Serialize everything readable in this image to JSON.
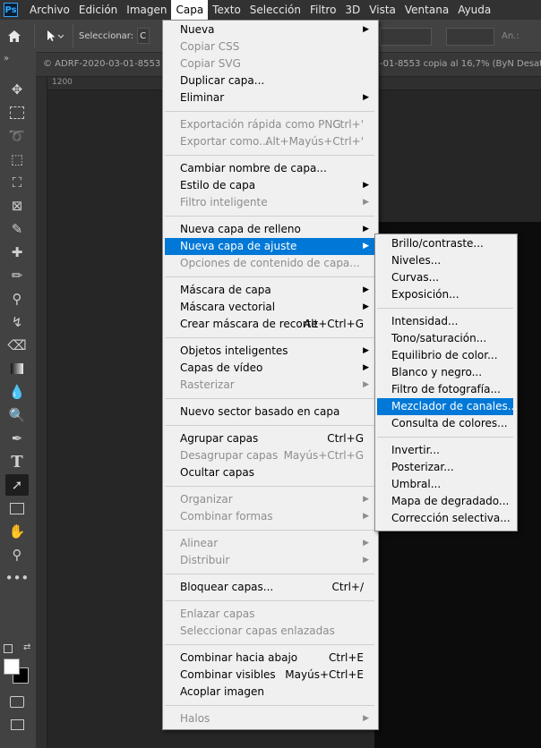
{
  "app": {
    "logo": "Ps"
  },
  "menubar": [
    "Archivo",
    "Edición",
    "Imagen",
    "Capa",
    "Texto",
    "Selección",
    "Filtro",
    "3D",
    "Vista",
    "Ventana",
    "Ayuda"
  ],
  "options": {
    "select_label": "Seleccionar:",
    "select_value": "C",
    "extra_label": "An.:"
  },
  "tabs": {
    "left": "© ADRF-2020-03-01-8553",
    "right": "-01-8553 copia al 16,7% (ByN Desat"
  },
  "ruler": {
    "tick": "1200"
  },
  "tools": {
    "double_arrow": "»"
  },
  "layer_menu": [
    {
      "label": "Nueva",
      "sub": true
    },
    {
      "label": "Copiar CSS",
      "disabled": true
    },
    {
      "label": "Copiar SVG",
      "disabled": true
    },
    {
      "label": "Duplicar capa..."
    },
    {
      "label": "Eliminar",
      "sub": true
    },
    {
      "sep": true
    },
    {
      "label": "Exportación rápida como PNG",
      "shortcut": "Ctrl+'",
      "disabled": true
    },
    {
      "label": "Exportar como...",
      "shortcut": "Alt+Mayús+Ctrl+'",
      "disabled": true
    },
    {
      "sep": true
    },
    {
      "label": "Cambiar nombre de capa..."
    },
    {
      "label": "Estilo de capa",
      "sub": true
    },
    {
      "label": "Filtro inteligente",
      "sub": true,
      "disabled": true
    },
    {
      "sep": true
    },
    {
      "label": "Nueva capa de relleno",
      "sub": true
    },
    {
      "label": "Nueva capa de ajuste",
      "sub": true,
      "highlighted": true
    },
    {
      "label": "Opciones de contenido de capa...",
      "disabled": true
    },
    {
      "sep": true
    },
    {
      "label": "Máscara de capa",
      "sub": true
    },
    {
      "label": "Máscara vectorial",
      "sub": true
    },
    {
      "label": "Crear máscara de recorte",
      "shortcut": "Alt+Ctrl+G"
    },
    {
      "sep": true
    },
    {
      "label": "Objetos inteligentes",
      "sub": true
    },
    {
      "label": "Capas de vídeo",
      "sub": true
    },
    {
      "label": "Rasterizar",
      "sub": true,
      "disabled": true
    },
    {
      "sep": true
    },
    {
      "label": "Nuevo sector basado en capa"
    },
    {
      "sep": true
    },
    {
      "label": "Agrupar capas",
      "shortcut": "Ctrl+G"
    },
    {
      "label": "Desagrupar capas",
      "shortcut": "Mayús+Ctrl+G",
      "disabled": true
    },
    {
      "label": "Ocultar capas"
    },
    {
      "sep": true
    },
    {
      "label": "Organizar",
      "sub": true,
      "disabled": true
    },
    {
      "label": "Combinar formas",
      "sub": true,
      "disabled": true
    },
    {
      "sep": true
    },
    {
      "label": "Alinear",
      "sub": true,
      "disabled": true
    },
    {
      "label": "Distribuir",
      "sub": true,
      "disabled": true
    },
    {
      "sep": true
    },
    {
      "label": "Bloquear capas...",
      "shortcut": "Ctrl+/"
    },
    {
      "sep": true
    },
    {
      "label": "Enlazar capas",
      "disabled": true
    },
    {
      "label": "Seleccionar capas enlazadas",
      "disabled": true
    },
    {
      "sep": true
    },
    {
      "label": "Combinar hacia abajo",
      "shortcut": "Ctrl+E"
    },
    {
      "label": "Combinar visibles",
      "shortcut": "Mayús+Ctrl+E"
    },
    {
      "label": "Acoplar imagen"
    },
    {
      "sep": true
    },
    {
      "label": "Halos",
      "sub": true,
      "disabled": true
    }
  ],
  "adjust_menu": [
    {
      "label": "Brillo/contraste..."
    },
    {
      "label": "Niveles..."
    },
    {
      "label": "Curvas..."
    },
    {
      "label": "Exposición..."
    },
    {
      "sep": true
    },
    {
      "label": "Intensidad..."
    },
    {
      "label": "Tono/saturación..."
    },
    {
      "label": "Equilibrio de color..."
    },
    {
      "label": "Blanco y negro..."
    },
    {
      "label": "Filtro de fotografía..."
    },
    {
      "label": "Mezclador de canales...",
      "highlighted": true
    },
    {
      "label": "Consulta de colores..."
    },
    {
      "sep": true
    },
    {
      "label": "Invertir..."
    },
    {
      "label": "Posterizar..."
    },
    {
      "label": "Umbral..."
    },
    {
      "label": "Mapa de degradado..."
    },
    {
      "label": "Corrección selectiva..."
    }
  ],
  "colors": {
    "accent": "#0078d7",
    "menu_bg": "#f0f0f0",
    "chrome": "#323232",
    "panel": "#424242"
  }
}
